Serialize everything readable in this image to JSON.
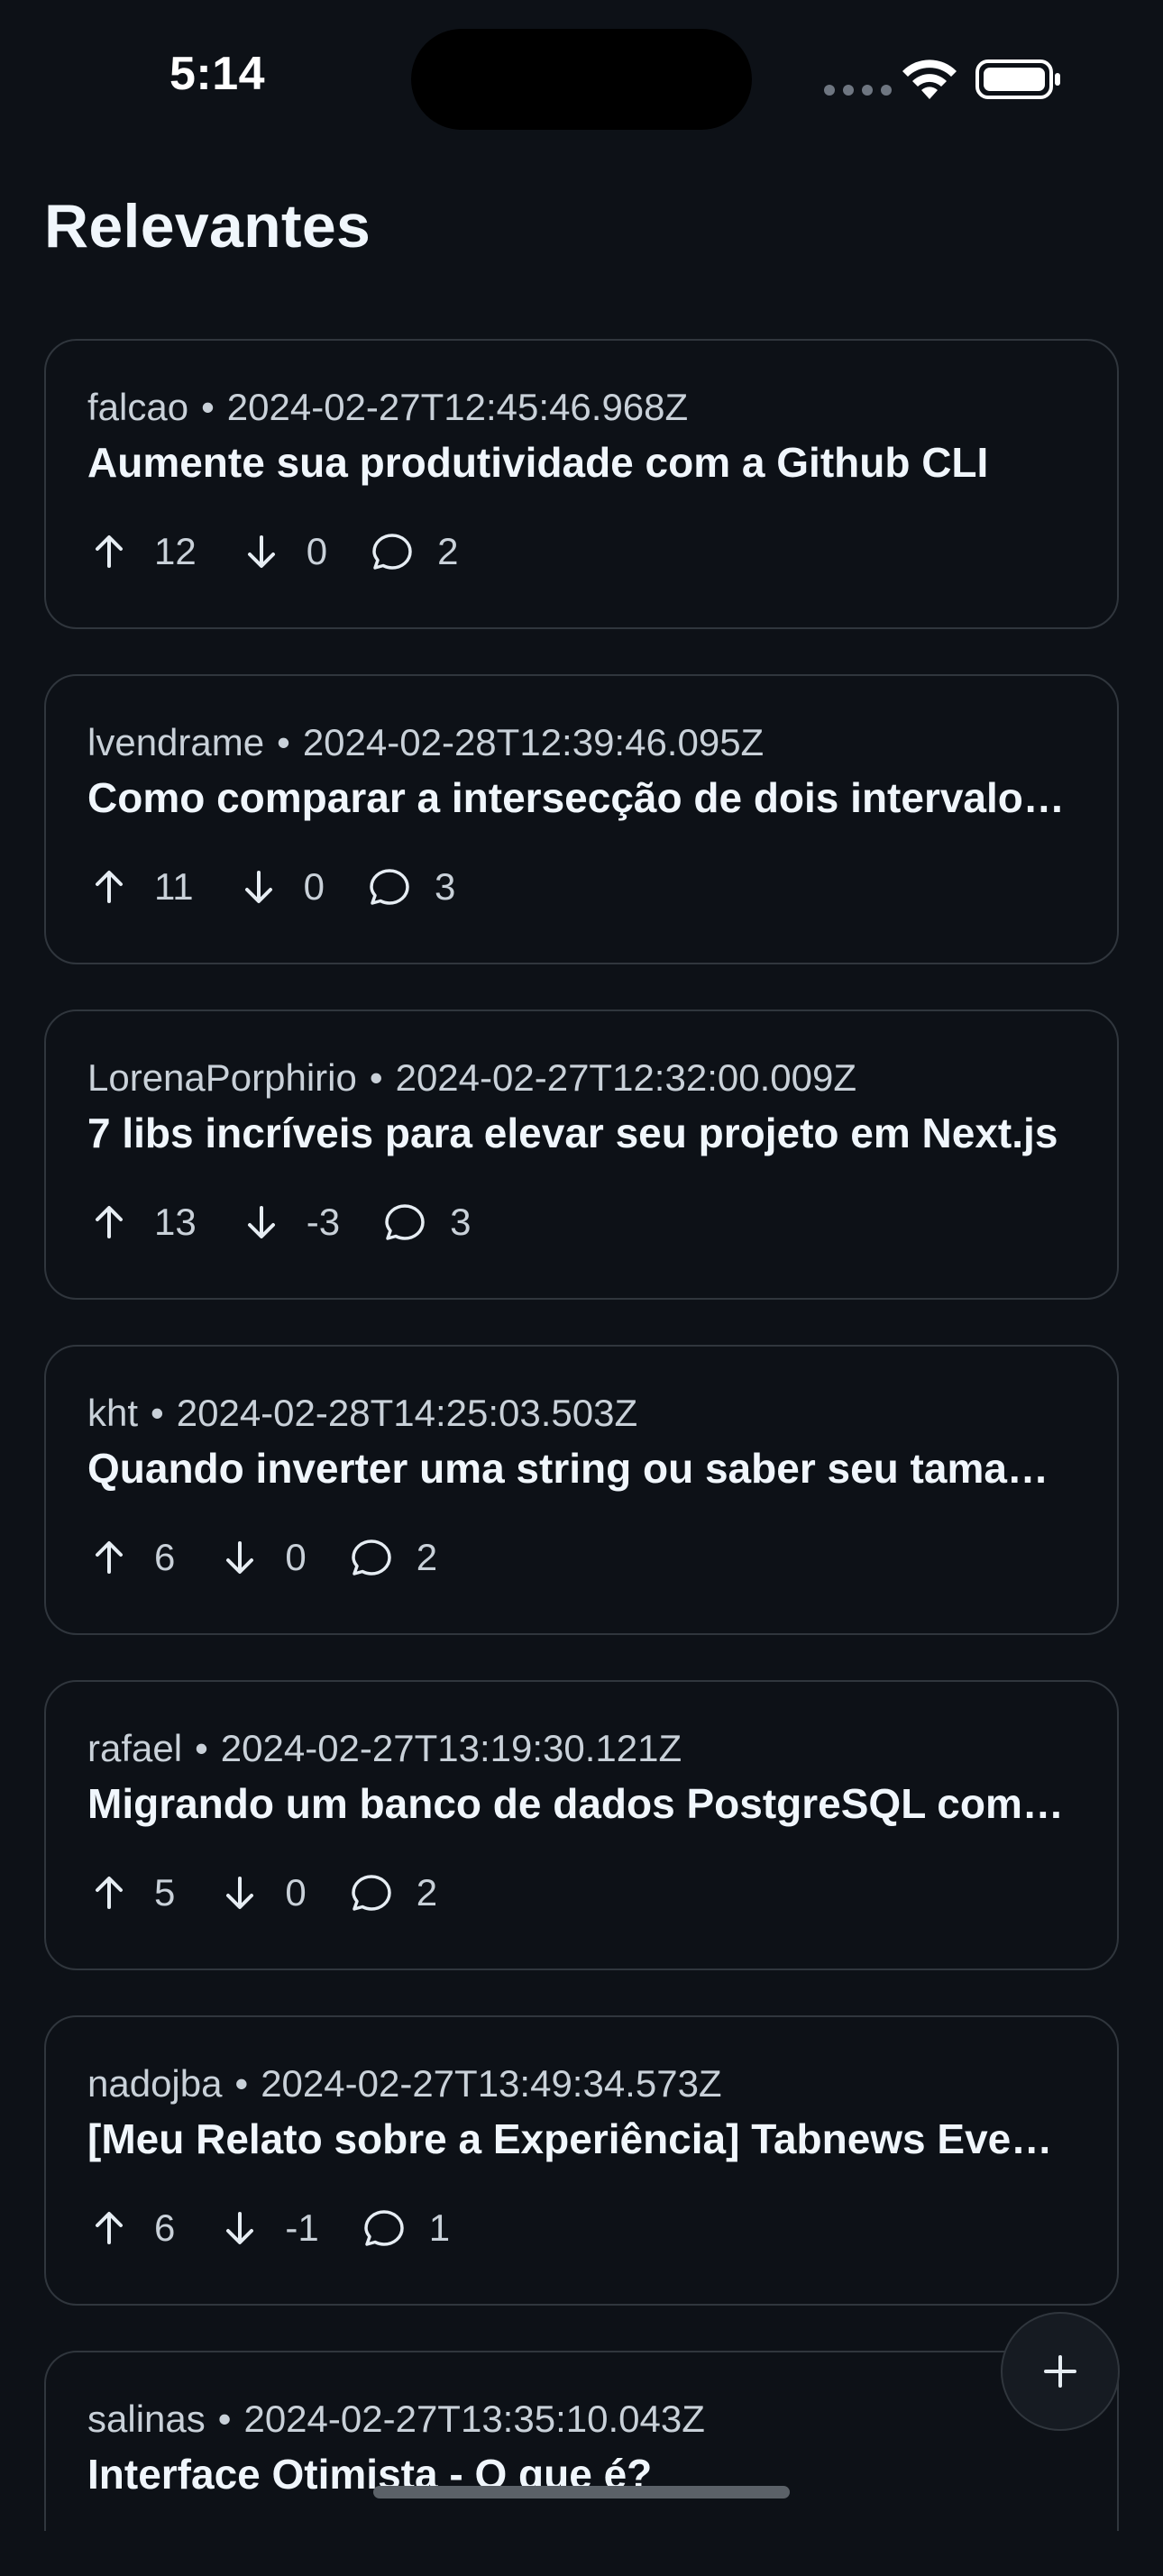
{
  "status_bar": {
    "time": "5:14"
  },
  "page": {
    "title": "Relevantes"
  },
  "posts": [
    {
      "author": "falcao",
      "date": "2024-02-27T12:45:46.968Z",
      "title": "Aumente sua produtividade com a Github CLI",
      "upvotes": "12",
      "downvotes": "0",
      "comments": "2"
    },
    {
      "author": "lvendrame",
      "date": "2024-02-28T12:39:46.095Z",
      "title": "Como comparar a intersecção de dois intervalos de datas",
      "upvotes": "11",
      "downvotes": "0",
      "comments": "3"
    },
    {
      "author": "LorenaPorphirio",
      "date": "2024-02-27T12:32:00.009Z",
      "title": "7 libs incríveis para elevar seu projeto em Next.js",
      "upvotes": "13",
      "downvotes": "-3",
      "comments": "3"
    },
    {
      "author": "kht",
      "date": "2024-02-28T14:25:03.503Z",
      "title": "Quando inverter uma string ou saber seu tamanho não é trivial",
      "upvotes": "6",
      "downvotes": "0",
      "comments": "2"
    },
    {
      "author": "rafael",
      "date": "2024-02-27T13:19:30.121Z",
      "title": "Migrando um banco de dados PostgreSQL com pg_dump",
      "upvotes": "5",
      "downvotes": "0",
      "comments": "2"
    },
    {
      "author": "nadojba",
      "date": "2024-02-27T13:49:34.573Z",
      "title": "[Meu Relato sobre a Experiência] Tabnews Evento",
      "upvotes": "6",
      "downvotes": "-1",
      "comments": "1"
    },
    {
      "author": "salinas",
      "date": "2024-02-27T13:35:10.043Z",
      "title": "Interface Otimista - O que é?"
    }
  ],
  "icons": {
    "upvote": "arrow-up-icon",
    "downvote": "arrow-down-icon",
    "comments": "comment-bubble-icon",
    "fab": "plus-icon"
  }
}
